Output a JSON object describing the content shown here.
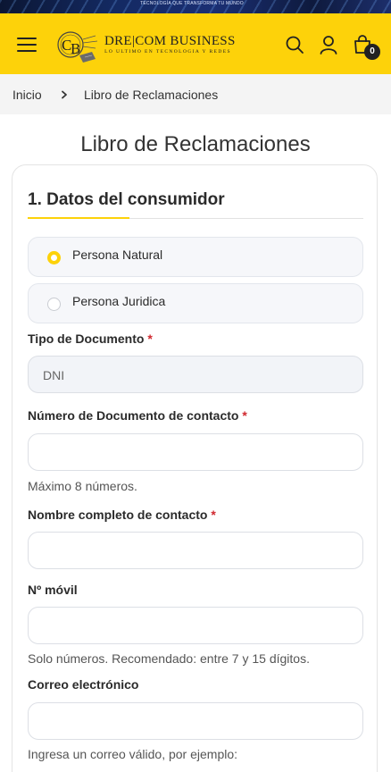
{
  "promo": {
    "text": "TECNOLOGÍA QUE TRANSFORMA TU MUNDO"
  },
  "header": {
    "brand_name": "DRE|COM BUSINESS",
    "brand_tagline": "LO ULTIMO EN TECNOLOGIA Y REDES",
    "cart_count": "0",
    "accent_color": "#fdd20a"
  },
  "breadcrumb": {
    "home": "Inicio",
    "current": "Libro de Reclamaciones"
  },
  "page": {
    "title": "Libro de Reclamaciones"
  },
  "form": {
    "section_title": "1. Datos del consumidor",
    "person_types": [
      {
        "label": "Persona Natural",
        "selected": true
      },
      {
        "label": "Persona Juridica",
        "selected": false
      }
    ],
    "doc_type": {
      "label": "Tipo de Documento",
      "required_mark": "*",
      "value": "DNI"
    },
    "doc_number": {
      "label": "Número de Documento de contacto",
      "required_mark": "*",
      "value": "",
      "hint": "Máximo 8 números."
    },
    "full_name": {
      "label": "Nombre completo de contacto",
      "required_mark": "*",
      "value": ""
    },
    "mobile": {
      "label": "Nº móvil",
      "value": "",
      "hint": "Solo números. Recomendado: entre 7 y 15 dígitos."
    },
    "email": {
      "label": "Correo electrónico",
      "value": "",
      "hint": "Ingresa un correo válido, por ejemplo:"
    }
  }
}
